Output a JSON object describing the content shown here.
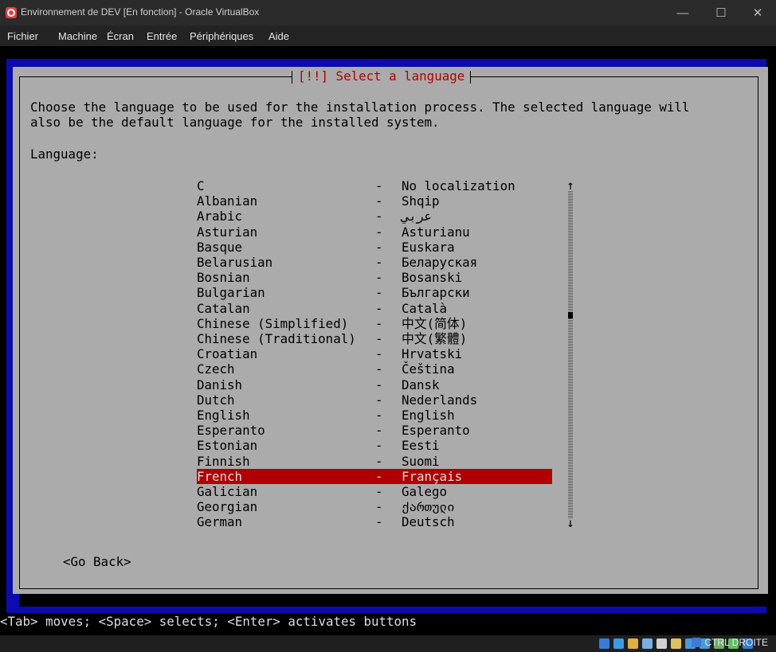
{
  "window": {
    "title": "Environnement de DEV [En fonction] - Oracle VirtualBox",
    "minimize": "—",
    "maximize": "☐",
    "close": "✕"
  },
  "menu": {
    "items": [
      "Fichier",
      "Machine",
      "Écran",
      "Entrée",
      "Périphériques",
      "Aide"
    ]
  },
  "installer": {
    "dialog_title": "[!!] Select a language",
    "description_line1": "Choose the language to be used for the installation process. The selected language will",
    "description_line2": "also be the default language for the installed system.",
    "language_label": "Language:",
    "separator": "-",
    "languages": [
      {
        "name": "C",
        "native": "No localization"
      },
      {
        "name": "Albanian",
        "native": "Shqip"
      },
      {
        "name": "Arabic",
        "native": "عربي"
      },
      {
        "name": "Asturian",
        "native": "Asturianu"
      },
      {
        "name": "Basque",
        "native": "Euskara"
      },
      {
        "name": "Belarusian",
        "native": "Беларуская"
      },
      {
        "name": "Bosnian",
        "native": "Bosanski"
      },
      {
        "name": "Bulgarian",
        "native": "Български"
      },
      {
        "name": "Catalan",
        "native": "Català"
      },
      {
        "name": "Chinese (Simplified)",
        "native": "中文(简体)"
      },
      {
        "name": "Chinese (Traditional)",
        "native": "中文(繁體)"
      },
      {
        "name": "Croatian",
        "native": "Hrvatski"
      },
      {
        "name": "Czech",
        "native": "Čeština"
      },
      {
        "name": "Danish",
        "native": "Dansk"
      },
      {
        "name": "Dutch",
        "native": "Nederlands"
      },
      {
        "name": "English",
        "native": "English"
      },
      {
        "name": "Esperanto",
        "native": "Esperanto"
      },
      {
        "name": "Estonian",
        "native": "Eesti"
      },
      {
        "name": "Finnish",
        "native": "Suomi"
      },
      {
        "name": "French",
        "native": "Français",
        "selected": true
      },
      {
        "name": "Galician",
        "native": "Galego"
      },
      {
        "name": "Georgian",
        "native": "ქართული"
      },
      {
        "name": "German",
        "native": "Deutsch"
      }
    ],
    "scroll_up": "↑",
    "scroll_down": "↓",
    "go_back": "<Go Back>",
    "help_line": "<Tab> moves; <Space> selects; <Enter> activates buttons"
  },
  "statusbar": {
    "host_key": "CTRL DROITE",
    "icons": [
      "hard-disk-icon",
      "optical-drive-icon",
      "audio-icon",
      "network-icon",
      "usb-icon",
      "shared-folders-icon",
      "display-icon",
      "video-capture-icon",
      "cpu-icon",
      "mouse-integration-icon",
      "keyboard-icon"
    ]
  },
  "colors": {
    "selection": "#b00000",
    "dialog_bg": "#ababab",
    "screen_bg": "#0b0bb0",
    "title_red": "#b00000"
  }
}
